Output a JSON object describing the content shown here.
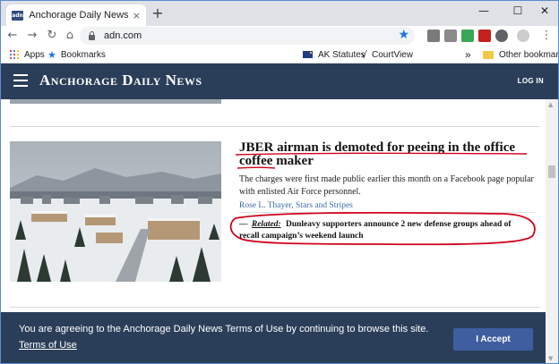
{
  "browser": {
    "tab": {
      "title": "Anchorage Daily News: Alaska N",
      "favicon_text": "adn",
      "close_glyph": "×"
    },
    "new_tab_glyph": "+",
    "window_controls": {
      "minimize": "—",
      "maximize": "☐",
      "close": "✕"
    },
    "nav": {
      "back": "←",
      "forward": "→",
      "reload": "↻",
      "home": "⌂"
    },
    "url": "adn.com",
    "star_glyph": "★",
    "menu_glyph": "⋮",
    "bookmarks": {
      "apps": "Apps",
      "bookmarks": "Bookmarks",
      "ak_statutes": "AK Statutes",
      "courtview": "CourtView",
      "more_glyph": "»",
      "other": "Other bookmarks"
    }
  },
  "site": {
    "logo": "Anchorage Daily News",
    "login": "LOG IN"
  },
  "article": {
    "headline": "JBER airman is demoted for peeing in the office coffee maker",
    "summary": "The charges were first made public earlier this month on a Facebook page popular with enlisted Air Force personnel.",
    "byline": "Rose L. Thayer, Stars and Stripes",
    "related": {
      "dash": "—",
      "label": "Related:",
      "text": "Dunleavy supporters announce 2 new defense groups ahead of recall campaign’s weekend launch"
    }
  },
  "consent": {
    "text": "You are agreeing to the Anchorage Daily News Terms of Use by continuing to browse this site.",
    "link": "Terms of Use",
    "button": "I Accept"
  },
  "colors": {
    "header_bg": "#2b3e59",
    "accept_bg": "#3f5ea0",
    "annotation_red": "#d0021b",
    "byline_blue": "#3d6aa8"
  }
}
